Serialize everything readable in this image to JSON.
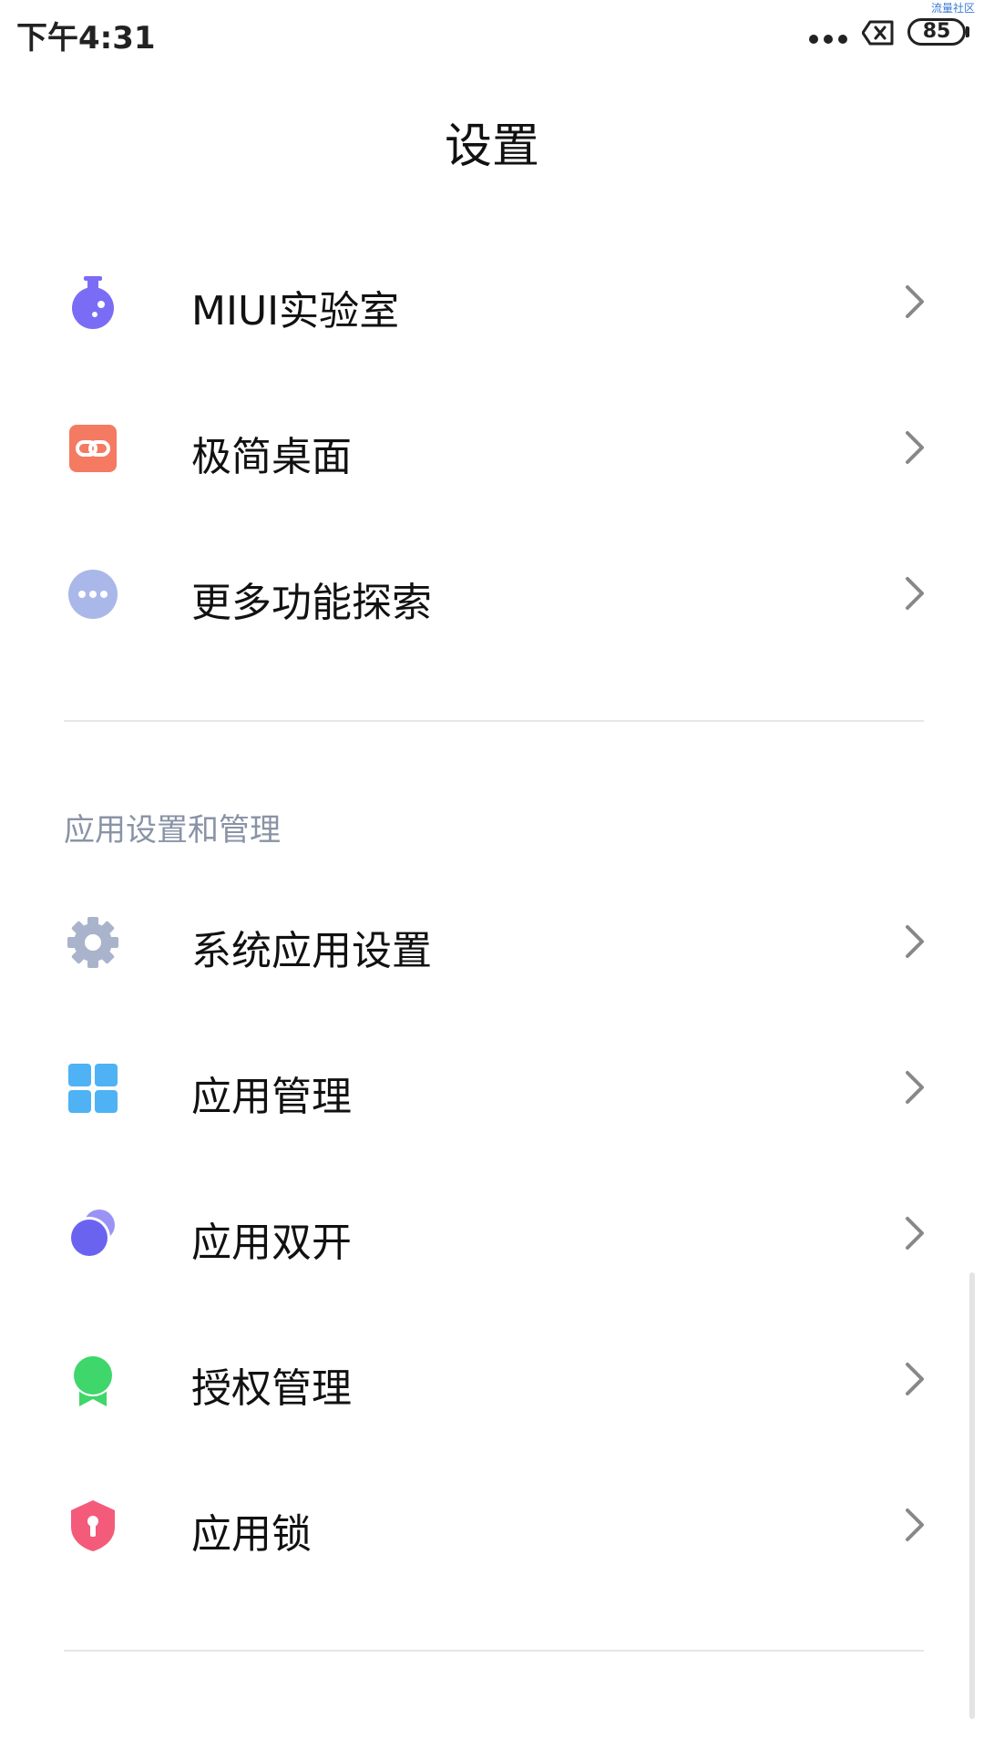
{
  "status_bar": {
    "time": "下午4:31",
    "battery": "85",
    "watermark": "流量社区"
  },
  "header": {
    "title": "设置"
  },
  "group1": {
    "items": [
      {
        "label": "MIUI实验室",
        "icon": "flask-icon",
        "color": "#7b6cf6"
      },
      {
        "label": "极简桌面",
        "icon": "link-icon",
        "color": "#f47a62"
      },
      {
        "label": "更多功能探索",
        "icon": "more-icon",
        "color": "#a9b8e8"
      }
    ]
  },
  "group2": {
    "header": "应用设置和管理",
    "items": [
      {
        "label": "系统应用设置",
        "icon": "gear-icon",
        "color": "#a9b4cc"
      },
      {
        "label": "应用管理",
        "icon": "grid-icon",
        "color": "#4fb2f5"
      },
      {
        "label": "应用双开",
        "icon": "dual-circle-icon",
        "color": "#6a63f0"
      },
      {
        "label": "授权管理",
        "icon": "badge-icon",
        "color": "#3fd66b"
      },
      {
        "label": "应用锁",
        "icon": "shield-lock-icon",
        "color": "#f45b7a"
      }
    ]
  }
}
